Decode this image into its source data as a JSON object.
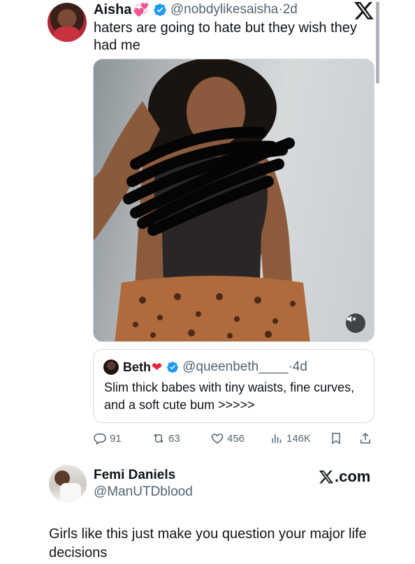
{
  "tweet": {
    "author_name": "Aisha",
    "author_emoji": "💞",
    "handle": "@nobdylikesaisha",
    "separator": "·",
    "age": "2d",
    "text": "haters are going to hate but they wish they had me",
    "platform_icon": "x-logo-icon",
    "media_control_icon": "speaker-muted-icon"
  },
  "quote": {
    "author_name": "Beth",
    "author_emoji": "❤",
    "handle": "@queenbeth____",
    "separator": "·",
    "age": "4d",
    "text": "Slim thick babes with tiny waists, fine curves, and a soft cute bum >>>>>"
  },
  "actions": {
    "replies": "91",
    "reposts": "63",
    "likes": "456",
    "views": "146K"
  },
  "reply": {
    "name": "Femi Daniels",
    "handle": "@ManUTDblood",
    "source": ".com",
    "text": "Girls like this just make you question your major life decisions"
  },
  "colors": {
    "text": "#0f1419",
    "secondary": "#536471",
    "verified": "#1d9bf0",
    "border": "#cfd9de"
  }
}
